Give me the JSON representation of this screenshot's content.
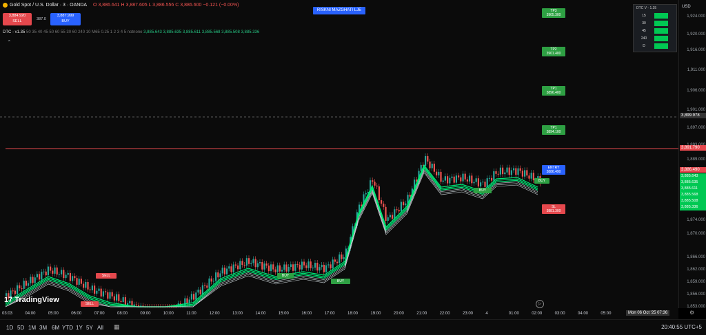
{
  "symbol": {
    "title": "Gold Spot / U.S. Dollar · 3 · OANDA",
    "ohlc": "O 3,886.641 H 3,887.605 L 3,886.556 C 3,886.600 −0.121 (−0.00%)",
    "sell_price": "3,884.920",
    "sell_label": "SELL",
    "spread": "387.0",
    "buy_price": "3,887.999",
    "buy_label": "BUY"
  },
  "indicator": {
    "name": "DTC - v1.35",
    "params": "50 35 40 45 50 60 55 30 60 240 10 M65 0.25 1 2 3 4 5 notnone",
    "values": "3,885.643  3,885.635  3,885.611  3,885.568  3,885.508  3,885.336"
  },
  "banner": "RISKNI MAZGHATI LJE",
  "table": {
    "title": "DTC V - 1.35",
    "rows": [
      {
        "tf": "15"
      },
      {
        "tf": "30"
      },
      {
        "tf": "45"
      },
      {
        "tf": "240"
      },
      {
        "tf": "D"
      }
    ]
  },
  "price_axis": {
    "currency": "USD",
    "ticks": [
      "1,924.000",
      "1,920.000",
      "1,916.000",
      "1,911.000",
      "1,906.000",
      "1,901.000",
      "1,897.000",
      "1,893.000",
      "1,889.000",
      "1,874.000",
      "1,870.000",
      "1,866.000",
      "1,862.000",
      "1,859.000",
      "1,856.000",
      "1,853.000"
    ],
    "crosshair_price": "3,899.978",
    "red_line_price": "3,891.790",
    "current_price": "3,886.490",
    "green_stack": [
      "3,885.643",
      "3,885.635",
      "3,885.611",
      "3,885.568",
      "3,885.508",
      "3,885.336"
    ]
  },
  "levels": {
    "tp3": "TP3\n3905.300",
    "tp2": "TP2\n3901.400",
    "tp1": "TP1\n3896.400",
    "tp0": "TP1\n3894.100",
    "entry": "ENTRY\n3886.490",
    "sl": "SL\n3881.300"
  },
  "signals": [
    {
      "label": "SELL"
    },
    {
      "label": "SELL"
    },
    {
      "label": "BUY"
    },
    {
      "label": "BUY"
    },
    {
      "label": "BUY"
    },
    {
      "label": "BUY"
    }
  ],
  "time_axis": [
    "03:03",
    "04:00",
    "05:00",
    "06:00",
    "07:00",
    "08:00",
    "09:00",
    "10:00",
    "11:00",
    "12:00",
    "13:00",
    "14:00",
    "15:00",
    "16:00",
    "17:00",
    "18:00",
    "19:00",
    "20:00",
    "21:00",
    "22:00",
    "23:00",
    "4",
    "01:00",
    "02:00",
    "03:00",
    "04:00",
    "05:00"
  ],
  "time_cursor": "Mon 06 Oct '25  07:36",
  "logo": "TradingView",
  "timeframes": [
    "1D",
    "5D",
    "1M",
    "3M",
    "6M",
    "YTD",
    "1Y",
    "5Y",
    "All"
  ],
  "clock": "20:40:55 UTC+5",
  "colors": {
    "bull": "#26a69a",
    "bear": "#ef5350",
    "ema": "#00e676",
    "redline": "#e5484d",
    "accent": "#2962ff"
  }
}
